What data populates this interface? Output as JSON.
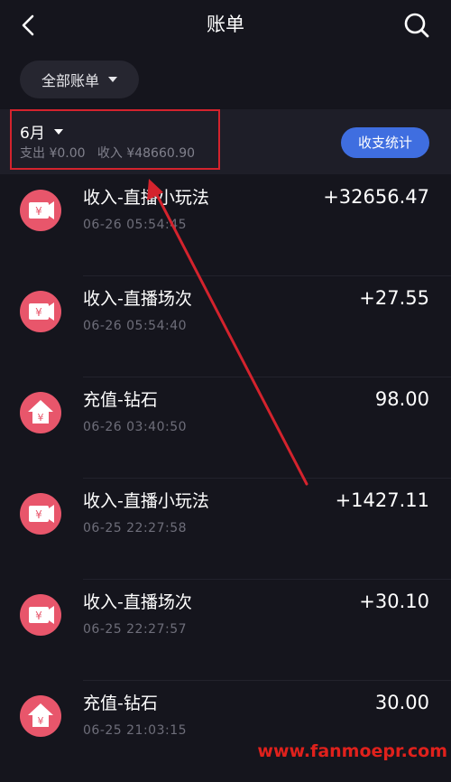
{
  "header": {
    "title": "账单",
    "back_icon": "chevron-left-icon",
    "search_icon": "search-icon"
  },
  "filter": {
    "label": "全部账单"
  },
  "month_bar": {
    "month": "6月",
    "summary": "支出 ¥0.00   收入 ¥48660.90",
    "stats_button": "收支统计"
  },
  "transactions": [
    {
      "title": "收入-直播小玩法",
      "time": "06-26 05:54:45",
      "amount": "+32656.47",
      "icon": "yen-ticket-icon"
    },
    {
      "title": "收入-直播场次",
      "time": "06-26 05:54:40",
      "amount": "+27.55",
      "icon": "yen-ticket-icon"
    },
    {
      "title": "充值-钻石",
      "time": "06-26 03:40:50",
      "amount": "98.00",
      "icon": "recharge-house-icon"
    },
    {
      "title": "收入-直播小玩法",
      "time": "06-25 22:27:58",
      "amount": "+1427.11",
      "icon": "yen-ticket-icon"
    },
    {
      "title": "收入-直播场次",
      "time": "06-25 22:27:57",
      "amount": "+30.10",
      "icon": "yen-ticket-icon"
    },
    {
      "title": "充值-钻石",
      "time": "06-25 21:03:15",
      "amount": "30.00",
      "icon": "recharge-house-icon"
    }
  ],
  "watermark": "www.fanmoepr.com",
  "colors": {
    "background": "#15151d",
    "accent_blue": "#3f6ee0",
    "badge_pink": "#e8566b",
    "annotation_red": "#d4232d"
  }
}
